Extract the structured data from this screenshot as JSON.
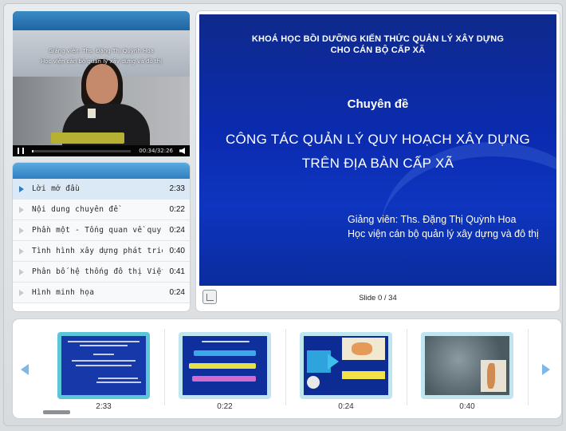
{
  "video": {
    "caption_line1": "Giảng viên: Ths. Đặng Thị Quỳnh Hoa",
    "caption_line2": "Học viện cán bộ quản lý xây dựng và đô thị",
    "time": "00:34/32:26",
    "progress": 0.017
  },
  "chapters": [
    {
      "title": "Lời mở đầu",
      "duration": "2:33",
      "active": true
    },
    {
      "title": "Nội dung chuyên đề",
      "duration": "0:22",
      "active": false
    },
    {
      "title": "Phần một - Tổng quan về quy h",
      "duration": "0:24",
      "active": false
    },
    {
      "title": "Tình hình xây dựng phát triển đ",
      "duration": "0:40",
      "active": false
    },
    {
      "title": "Phân bố hệ thống đô thị Việt N",
      "duration": "0:41",
      "active": false
    },
    {
      "title": "Hình minh họa",
      "duration": "0:24",
      "active": false
    }
  ],
  "slide": {
    "course_line1": "KHOÁ HỌC BỒI DƯỠNG KIẾN THỨC QUẢN LÝ XÂY DỰNG",
    "course_line2": "CHO CÁN BỘ CẤP XÃ",
    "chuyen_de": "Chuyên đề",
    "topic_line1": "CÔNG TÁC QUẢN LÝ QUY HOẠCH  XÂY  DỰNG",
    "topic_line2": "TRÊN ĐỊA BÀN CẤP XÃ",
    "lecturer_line1": "Giảng viên: Ths. Đặng Thị Quỳnh Hoa",
    "lecturer_line2": "Học viện cán bộ quản lý xây dựng và đô thị",
    "counter": "Slide 0 / 34"
  },
  "thumbnails": [
    {
      "time": "2:33",
      "active": true
    },
    {
      "time": "0:22",
      "active": false
    },
    {
      "time": "0:24",
      "active": false
    },
    {
      "time": "0:40",
      "active": false
    }
  ],
  "colors": {
    "accent": "#2f7fc1",
    "slide_bg": "#0b2bb0",
    "thumb_active": "#5bc6d8"
  }
}
